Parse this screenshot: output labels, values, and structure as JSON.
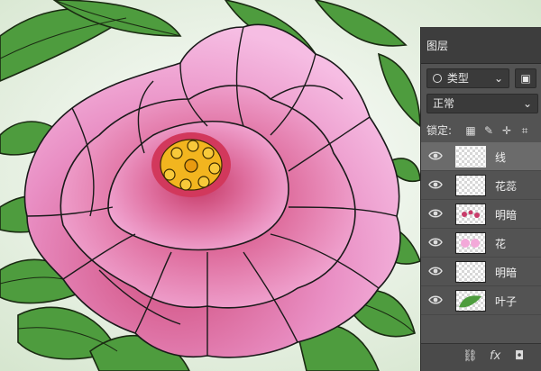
{
  "colors": {
    "panel_bg": "#535353",
    "petal_light": "#f3a9d9",
    "petal_mid": "#e07db4",
    "petal_dark": "#c83c6a",
    "leaf": "#4e9c3e",
    "stamen": "#f2b51f"
  },
  "layers_panel": {
    "tab_label": "图层",
    "filter": {
      "label": "类型",
      "icon": "search-icon"
    },
    "blend_mode": "正常",
    "lock_label": "锁定:",
    "layers": [
      {
        "name": "线",
        "selected": true,
        "thumb": "lines"
      },
      {
        "name": "花蕊",
        "selected": false,
        "thumb": "empty"
      },
      {
        "name": "明暗",
        "selected": false,
        "thumb": "dots-red"
      },
      {
        "name": "花",
        "selected": false,
        "thumb": "pink"
      },
      {
        "name": "明暗",
        "selected": false,
        "thumb": "empty"
      },
      {
        "name": "叶子",
        "selected": false,
        "thumb": "green"
      }
    ],
    "footer": {
      "link": "⛓",
      "fx": "fx",
      "mask": "◘"
    }
  }
}
